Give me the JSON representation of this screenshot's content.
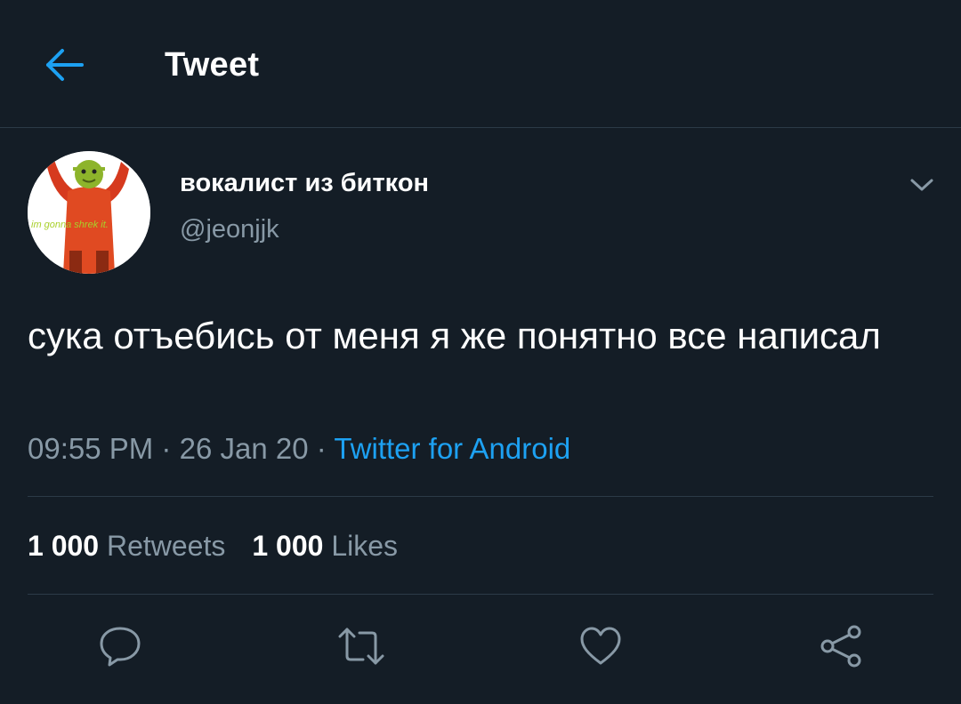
{
  "header": {
    "title": "Tweet",
    "back_icon": "arrow-left-icon"
  },
  "colors": {
    "background": "#141d26",
    "accent": "#1da1f2",
    "muted": "#8899a6",
    "divider": "#2c3a47"
  },
  "author": {
    "display_name": "вокалист из биткон",
    "handle": "@jeonjjk",
    "avatar_caption": "im gonna shrek it."
  },
  "tweet": {
    "text": "сука отъебись от меня я же понятно все написал",
    "time": "09:55 PM",
    "separator": "·",
    "date": "26 Jan 20",
    "source": "Twitter for Android"
  },
  "stats": {
    "retweets_count": "1 000",
    "retweets_label": "Retweets",
    "likes_count": "1 000",
    "likes_label": "Likes"
  },
  "actions": [
    {
      "name": "reply",
      "icon": "reply-icon"
    },
    {
      "name": "retweet",
      "icon": "retweet-icon"
    },
    {
      "name": "like",
      "icon": "heart-icon"
    },
    {
      "name": "share",
      "icon": "share-icon"
    }
  ]
}
